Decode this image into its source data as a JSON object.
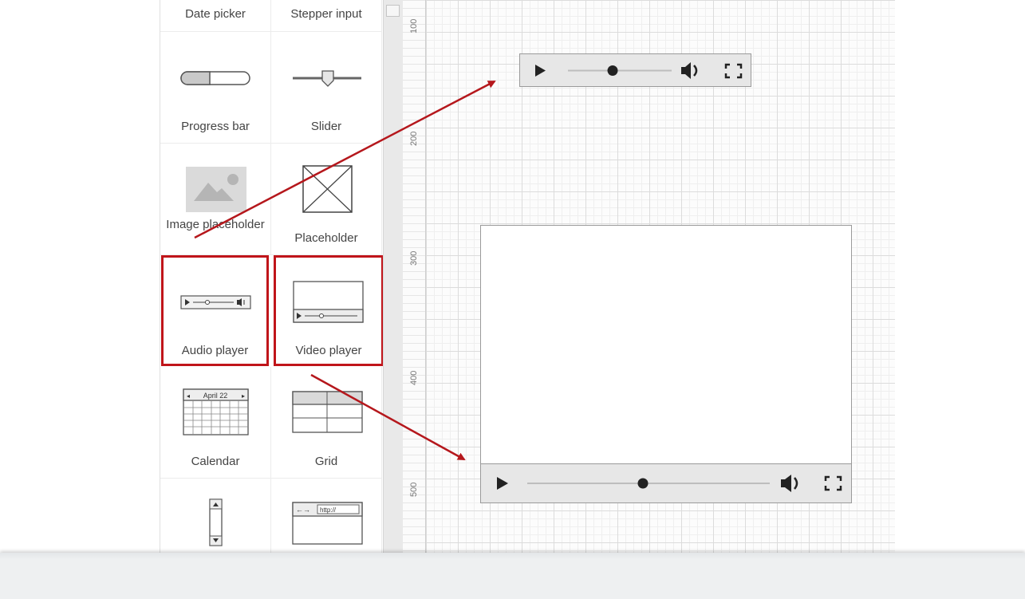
{
  "shapes_panel": {
    "items": [
      {
        "label": "Date picker"
      },
      {
        "label": "Stepper input"
      },
      {
        "label": "Progress bar"
      },
      {
        "label": "Slider"
      },
      {
        "label": "Image placeholder"
      },
      {
        "label": "Placeholder"
      },
      {
        "label": "Audio player"
      },
      {
        "label": "Video player"
      },
      {
        "label": "Calendar"
      },
      {
        "label": "Grid"
      }
    ],
    "calendar_month": "April 22",
    "browser_url": "http://"
  },
  "ruler": {
    "labels": [
      "100",
      "200",
      "300",
      "400",
      "500"
    ]
  },
  "annotation": {
    "highlight_color": "#c0151a"
  }
}
